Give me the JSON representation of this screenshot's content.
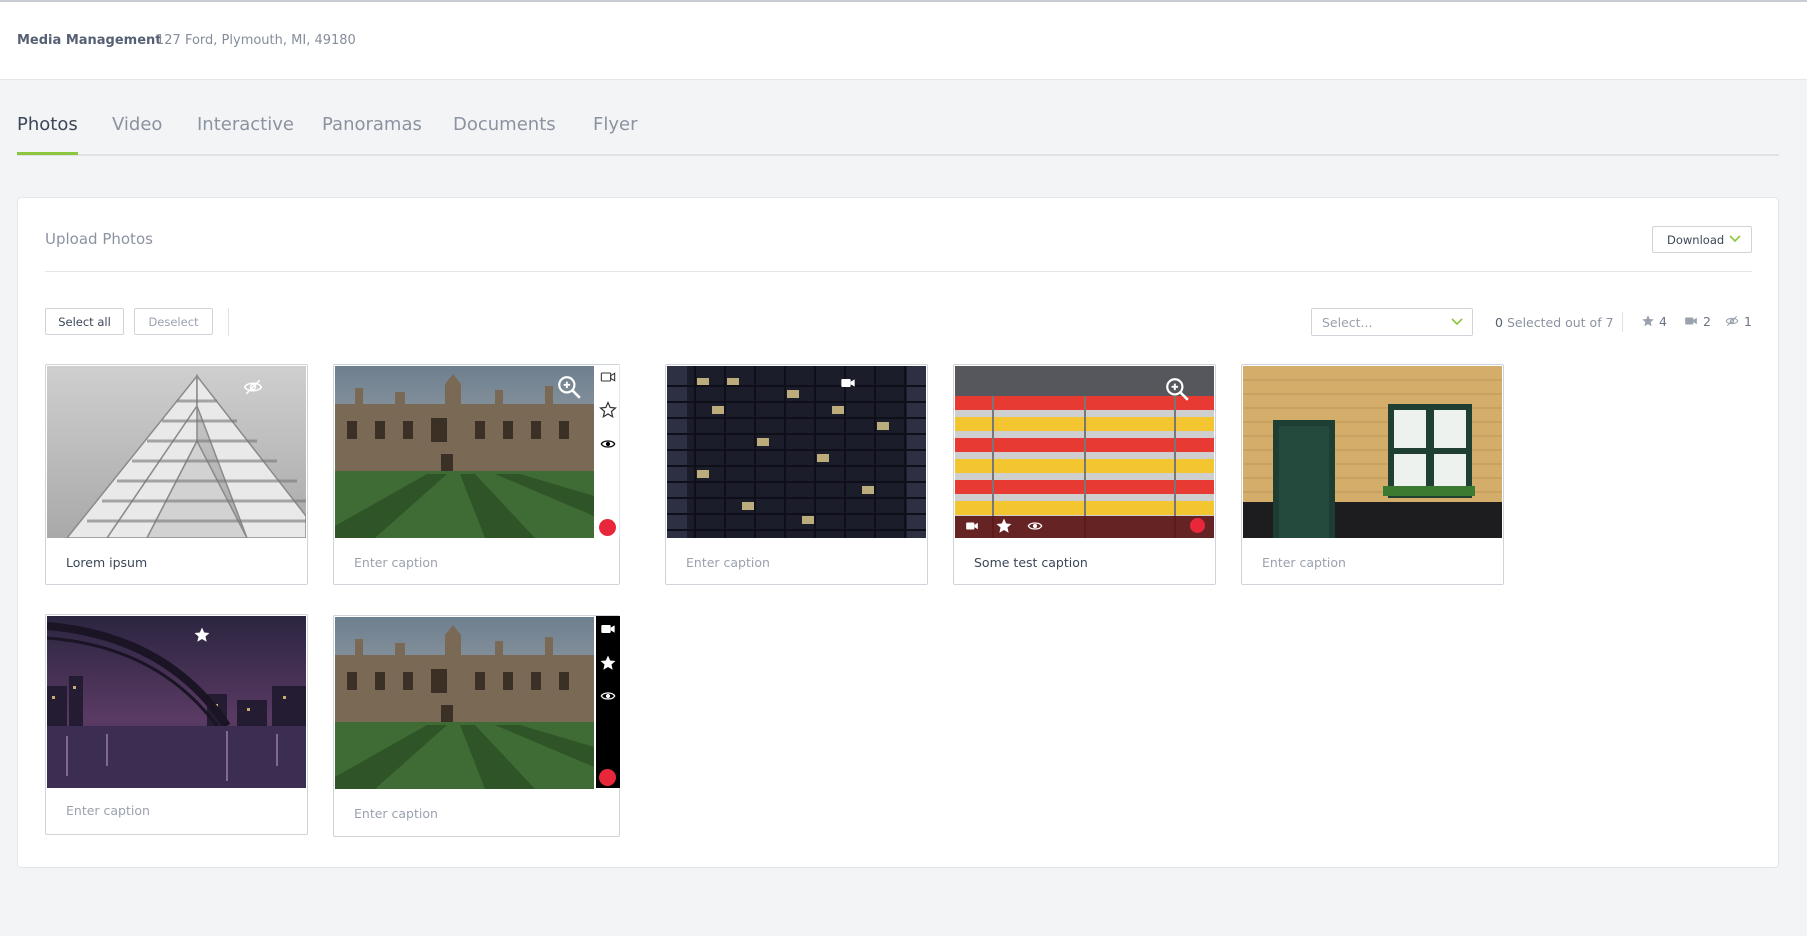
{
  "header": {
    "title": "Media Management",
    "address": "127 Ford, Plymouth, MI, 49180"
  },
  "tabs": [
    {
      "label": "Photos",
      "active": true
    },
    {
      "label": "Video",
      "active": false
    },
    {
      "label": "Interactive",
      "active": false
    },
    {
      "label": "Panoramas",
      "active": false
    },
    {
      "label": "Documents",
      "active": false
    },
    {
      "label": "Flyer",
      "active": false
    }
  ],
  "panel": {
    "title": "Upload Photos",
    "download_label": "Download"
  },
  "toolbar": {
    "select_all_label": "Select all",
    "deselect_label": "Deselect",
    "select_placeholder": "Select...",
    "selected_count": "0",
    "selected_suffix": "Selected out of 7",
    "stats": {
      "starred": "4",
      "video": "2",
      "hidden": "1"
    }
  },
  "photos": [
    {
      "caption": "Lorem ipsum",
      "has_caption": true,
      "icons": [
        "hidden-icon"
      ]
    },
    {
      "caption": "Enter caption",
      "has_caption": false,
      "icons": [
        "zoom-icon",
        "video-icon",
        "star-icon",
        "eye-icon",
        "trash-icon"
      ]
    },
    {
      "caption": "Enter caption",
      "has_caption": false,
      "icons": [
        "video-icon"
      ]
    },
    {
      "caption": "Some test caption",
      "has_caption": true,
      "icons": [
        "zoom-icon",
        "video-icon",
        "star-icon",
        "eye-icon",
        "trash-icon"
      ]
    },
    {
      "caption": "Enter caption",
      "has_caption": false,
      "icons": []
    },
    {
      "caption": "Enter caption",
      "has_caption": false,
      "icons": [
        "star-icon"
      ]
    },
    {
      "caption": "Enter caption",
      "has_caption": false,
      "icons": [
        "video-icon",
        "star-icon",
        "eye-icon",
        "trash-icon"
      ]
    }
  ],
  "colors": {
    "accent": "#8cc63f",
    "danger": "#e8283a",
    "text": "#3b4657",
    "muted": "#8b93a1"
  }
}
